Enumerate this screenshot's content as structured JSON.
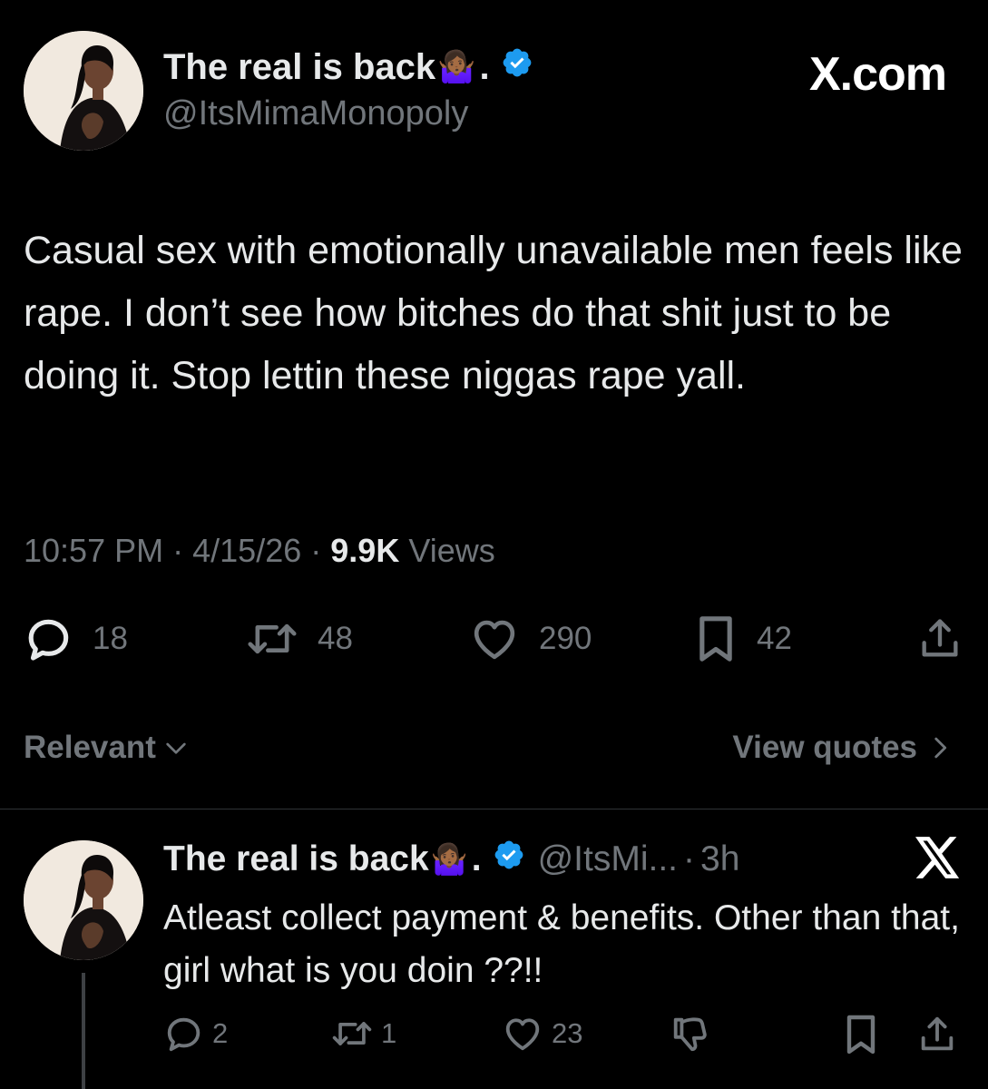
{
  "tweet": {
    "display_name": "The real is back",
    "emoji": "🤷🏾‍♀️",
    "dot": ".",
    "handle": "@ItsMimaMonopoly",
    "brand": "X.com",
    "text": "Casual sex with emotionally unavailable men feels like rape. I don’t see how bitches do that shit just to be doing it. Stop lettin these niggas rape yall.",
    "time": "10:57 PM",
    "date": "4/15/26",
    "sep": "·",
    "views_count": "9.9K",
    "views_label": "Views",
    "replies": "18",
    "reposts": "48",
    "likes": "290",
    "bookmarks": "42"
  },
  "sort": {
    "relevant_label": "Relevant",
    "view_quotes_label": "View quotes"
  },
  "reply": {
    "display_name": "The real is back",
    "emoji": "🤷🏾‍♀️",
    "dot": ".",
    "handle": "@ItsMi...",
    "sep": "·",
    "age": "3h",
    "text": "Atleast collect payment & benefits. Other than that, girl what is you doin ??!!",
    "replies": "2",
    "reposts": "1",
    "likes": "23"
  },
  "colors": {
    "background": "#000000",
    "text_primary": "#e7e9ea",
    "text_secondary": "#71767b",
    "verified": "#1d9bf0",
    "divider": "#2f3336"
  },
  "icons": [
    "verified-badge-icon",
    "reply-icon",
    "repost-icon",
    "like-icon",
    "bookmark-icon",
    "share-icon",
    "chevron-down-icon",
    "chevron-right-icon",
    "x-logo-icon",
    "downvote-icon"
  ]
}
